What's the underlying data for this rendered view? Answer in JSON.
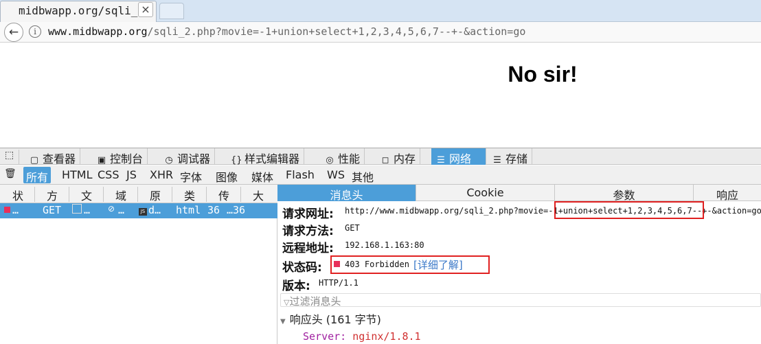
{
  "browser": {
    "tab_title": "midbwapp.org/sqli_",
    "tab_close": "×",
    "url_host": "www.midbwapp.org",
    "url_path": "/sqli_2.php?movie=-1+union+select+1,2,3,4,5,6,7--+-&action=go",
    "back_glyph": "←",
    "info_glyph": "i"
  },
  "page": {
    "heading": "No sir!"
  },
  "devtools": {
    "tabs": [
      {
        "icon": "▢",
        "label": "查看器"
      },
      {
        "icon": "▣",
        "label": "控制台"
      },
      {
        "icon": "◷",
        "label": "调试器"
      },
      {
        "icon": "{}",
        "label": "样式编辑器"
      },
      {
        "icon": "◎",
        "label": "性能"
      },
      {
        "icon": "◻",
        "label": "内存"
      },
      {
        "icon": "☰",
        "label": "网络"
      },
      {
        "icon": "☰",
        "label": "存储"
      }
    ],
    "filters": [
      "所有",
      "HTML",
      "CSS",
      "JS",
      "XHR",
      "字体",
      "图像",
      "媒体",
      "Flash",
      "WS",
      "其他"
    ],
    "trash_glyph": "🗑",
    "columns": [
      "状",
      "方",
      "文",
      "域",
      "原",
      "类",
      "传",
      "大"
    ],
    "request_row": {
      "status": "…",
      "method": "GET",
      "file": "…",
      "domain": "…",
      "cause": "d…",
      "type": "html",
      "transferred": "36",
      "size": "…36"
    },
    "detail_tabs": [
      "消息头",
      "Cookie",
      "参数",
      "响应"
    ],
    "headers": {
      "request_url_label": "请求网址:",
      "request_url_value": "http://www.midbwapp.org/sqli_2.php?movie=-1+union+select+1,2,3,4,5,6,7--+-&action=go",
      "method_label": "请求方法:",
      "method_value": "GET",
      "remote_label": "远程地址:",
      "remote_value": "192.168.1.163:80",
      "status_label": "状态码:",
      "status_value": "403 Forbidden",
      "status_link": "[详细了解]",
      "version_label": "版本:",
      "version_value": "HTTP/1.1",
      "filter_placeholder": "过滤消息头",
      "response_headers": "响应头 (161 字节)",
      "server_name": "Server:",
      "server_value": "nginx/1.8.1"
    }
  },
  "colors": {
    "accent": "#4c9ed9",
    "error": "#e02020",
    "status_dot": "#e8305a"
  }
}
